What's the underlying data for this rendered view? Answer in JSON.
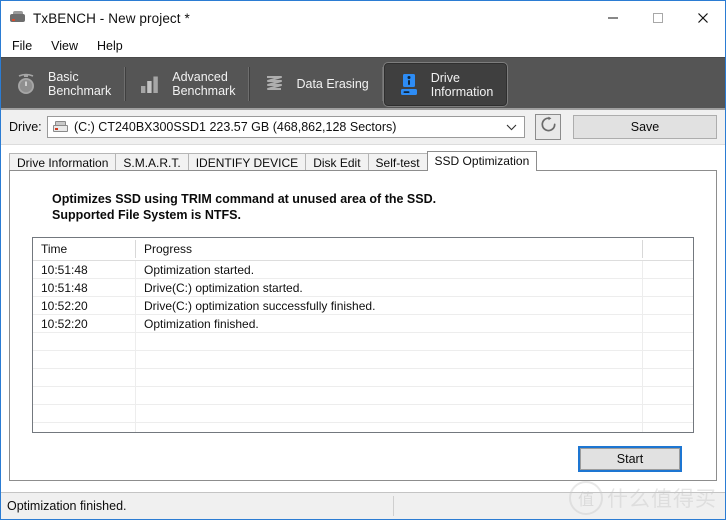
{
  "window": {
    "title": "TxBENCH - New project *",
    "app_icon": "drive-app-icon",
    "controls": {
      "minimize": "minimize-icon",
      "maximize": "maximize-icon",
      "close": "close-icon"
    }
  },
  "menubar": {
    "items": [
      "File",
      "View",
      "Help"
    ]
  },
  "top_tabs": [
    {
      "label": "Basic\nBenchmark",
      "icon": "stopwatch-icon",
      "active": false
    },
    {
      "label": "Advanced\nBenchmark",
      "icon": "bar-chart-icon",
      "active": false
    },
    {
      "label": "Data Erasing",
      "icon": "shredder-icon",
      "active": false
    },
    {
      "label": "Drive\nInformation",
      "icon": "drive-info-icon",
      "active": true
    }
  ],
  "drive_row": {
    "label": "Drive:",
    "combo_value": "(C:) CT240BX300SSD1  223.57 GB (468,862,128 Sectors)",
    "combo_icon": "hard-drive-icon",
    "refresh_icon": "refresh-icon",
    "save_label": "Save"
  },
  "inner_tabs": [
    {
      "label": "Drive Information",
      "active": false
    },
    {
      "label": "S.M.A.R.T.",
      "active": false
    },
    {
      "label": "IDENTIFY DEVICE",
      "active": false
    },
    {
      "label": "Disk Edit",
      "active": false
    },
    {
      "label": "Self-test",
      "active": false
    },
    {
      "label": "SSD Optimization",
      "active": true
    }
  ],
  "panel": {
    "description_line1": "Optimizes SSD using TRIM command at unused area of the SSD.",
    "description_line2": "Supported File System is NTFS.",
    "grid": {
      "columns": [
        "Time",
        "Progress"
      ],
      "rows": [
        {
          "time": "10:51:48",
          "progress": "Optimization started."
        },
        {
          "time": "10:51:48",
          "progress": "Drive(C:) optimization started."
        },
        {
          "time": "10:52:20",
          "progress": "Drive(C:) optimization successfully finished."
        },
        {
          "time": "10:52:20",
          "progress": "Optimization finished."
        }
      ],
      "empty_row_count": 8
    },
    "start_label": "Start"
  },
  "statusbar": {
    "text": "Optimization finished."
  },
  "watermark": {
    "badge": "值",
    "text": "什么值得买"
  },
  "colors": {
    "accent_blue": "#2d8cf5",
    "focus_blue": "#1d76d2",
    "strip_bg": "#555555",
    "active_tab_bg": "#3f3f3f",
    "window_border": "#2b7cd3"
  }
}
